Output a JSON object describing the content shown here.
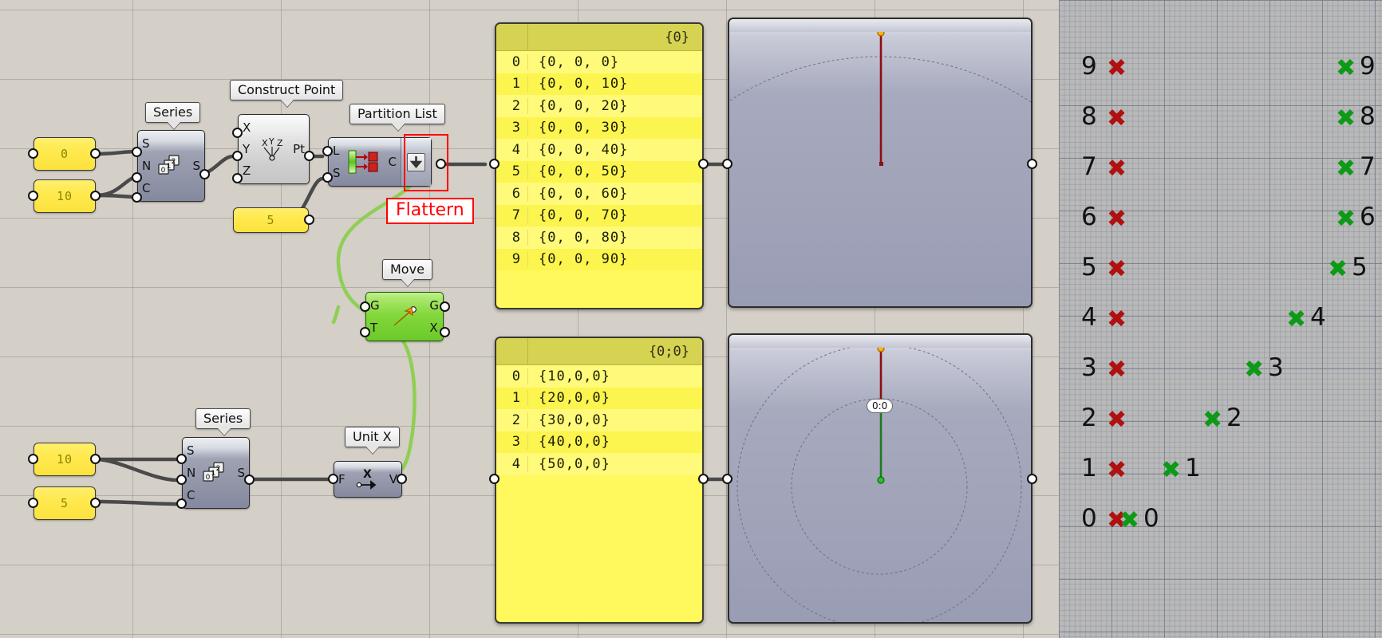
{
  "app": {
    "name": "Grasshopper definition canvas with Rhino viewport"
  },
  "canvas": {
    "sliders": [
      {
        "name": "series-top-start",
        "value": "0"
      },
      {
        "name": "series-top-count",
        "value": "10"
      },
      {
        "name": "partition-size",
        "value": "5"
      },
      {
        "name": "series-bottom-start",
        "value": "10"
      },
      {
        "name": "series-bottom-count",
        "value": "5"
      }
    ],
    "components": [
      {
        "id": "series-top",
        "label": "Series",
        "inputs": [
          "S",
          "N",
          "C"
        ],
        "outputs": [
          "S"
        ],
        "icon": "series-icon"
      },
      {
        "id": "construct-point",
        "label": "Construct Point",
        "inputs": [
          "X",
          "Y",
          "Z"
        ],
        "outputs": [
          "Pt"
        ],
        "icon": "xyz-point-icon"
      },
      {
        "id": "partition-list",
        "label": "Partition List",
        "inputs": [
          "L",
          "S"
        ],
        "outputs": [
          "C"
        ],
        "icon": "partition-list-icon",
        "flatten_icon": "down-arrow-icon"
      },
      {
        "id": "move",
        "label": "Move",
        "inputs": [
          "G",
          "T"
        ],
        "outputs": [
          "G",
          "X"
        ],
        "icon": "move-arrow-icon"
      },
      {
        "id": "series-bottom",
        "label": "Series",
        "inputs": [
          "S",
          "N",
          "C"
        ],
        "outputs": [
          "S"
        ],
        "icon": "series-icon"
      },
      {
        "id": "unit-x",
        "label": "Unit X",
        "inputs": [
          "F"
        ],
        "outputs": [
          "V"
        ],
        "icon": "unit-x-icon"
      }
    ],
    "annotation": {
      "label": "Flattern",
      "color": "#ff0000"
    }
  },
  "panels": [
    {
      "id": "panel-top",
      "header": "{0}",
      "rows": [
        {
          "index": "0",
          "value": "{0,  0,  0}"
        },
        {
          "index": "1",
          "value": "{0,  0,  10}"
        },
        {
          "index": "2",
          "value": "{0,  0,  20}"
        },
        {
          "index": "3",
          "value": "{0,  0,  30}"
        },
        {
          "index": "4",
          "value": "{0,  0,  40}"
        },
        {
          "index": "5",
          "value": "{0,  0,  50}"
        },
        {
          "index": "6",
          "value": "{0,  0,  60}"
        },
        {
          "index": "7",
          "value": "{0,  0,  70}"
        },
        {
          "index": "8",
          "value": "{0,  0,  80}"
        },
        {
          "index": "9",
          "value": "{0,  0,  90}"
        }
      ]
    },
    {
      "id": "panel-bottom",
      "header": "{0;0}",
      "rows": [
        {
          "index": "0",
          "value": "{10,0,0}"
        },
        {
          "index": "1",
          "value": "{20,0,0}"
        },
        {
          "index": "2",
          "value": "{30,0,0}"
        },
        {
          "index": "3",
          "value": "{40,0,0}"
        },
        {
          "index": "4",
          "value": "{50,0,0}"
        }
      ]
    }
  ],
  "viewports": [
    {
      "id": "viewport-top",
      "tag": ""
    },
    {
      "id": "viewport-bottom",
      "tag": "0:0"
    }
  ],
  "rhino": {
    "red_markers": [
      {
        "label": "9",
        "glyph": "✖"
      },
      {
        "label": "8",
        "glyph": "✖"
      },
      {
        "label": "7",
        "glyph": "✖"
      },
      {
        "label": "6",
        "glyph": "✖"
      },
      {
        "label": "5",
        "glyph": "✖"
      },
      {
        "label": "4",
        "glyph": "✖"
      },
      {
        "label": "3",
        "glyph": "✖"
      },
      {
        "label": "2",
        "glyph": "✖"
      },
      {
        "label": "1",
        "glyph": "✖"
      },
      {
        "label": "0",
        "glyph": "✖"
      }
    ],
    "green_markers": [
      {
        "label": "9",
        "glyph": "✖"
      },
      {
        "label": "8",
        "glyph": "✖"
      },
      {
        "label": "7",
        "glyph": "✖"
      },
      {
        "label": "6",
        "glyph": "✖"
      },
      {
        "label": "5",
        "glyph": "✖"
      },
      {
        "label": "4",
        "glyph": "✖"
      },
      {
        "label": "3",
        "glyph": "✖"
      },
      {
        "label": "2",
        "glyph": "✖"
      },
      {
        "label": "1",
        "glyph": "✖"
      },
      {
        "label": "0",
        "glyph": "✖"
      }
    ],
    "colors": {
      "red": "#b01010",
      "green": "#0d9a16"
    }
  },
  "ports": {
    "series_top": {
      "in": [
        "S",
        "N",
        "C"
      ],
      "out": [
        "S"
      ]
    },
    "construct_point": {
      "in": [
        "X",
        "Y",
        "Z"
      ],
      "out": [
        "Pt"
      ]
    },
    "partition_list": {
      "in": [
        "L",
        "S"
      ],
      "out": [
        "C"
      ]
    },
    "move": {
      "in": [
        "G",
        "T"
      ],
      "out": [
        "G",
        "X"
      ]
    },
    "series_bottom": {
      "in": [
        "S",
        "N",
        "C"
      ],
      "out": [
        "S"
      ]
    },
    "unit_x": {
      "in": [
        "F"
      ],
      "out": [
        "V"
      ]
    }
  }
}
